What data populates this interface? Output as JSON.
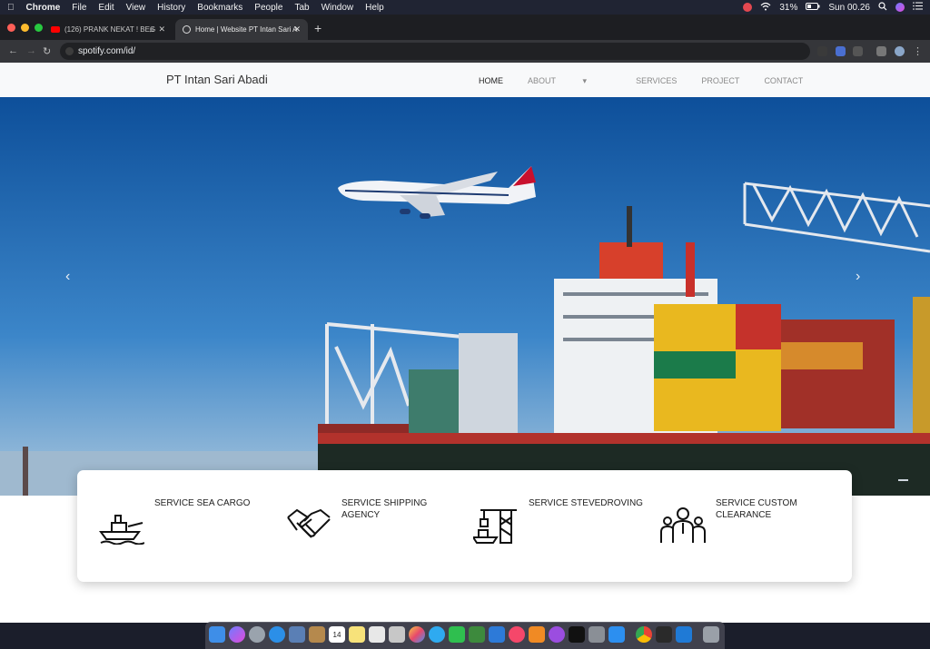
{
  "menubar": {
    "app": "Chrome",
    "items": [
      "File",
      "Edit",
      "View",
      "History",
      "Bookmarks",
      "People",
      "Tab",
      "Window",
      "Help"
    ],
    "battery": "31%",
    "clock": "Sun 00.26"
  },
  "tabs": [
    {
      "title": "(126) PRANK NEKAT ! BEG"
    },
    {
      "title": "Home | Website PT Intan Sari A"
    }
  ],
  "address": {
    "url": "spotify.com/id/"
  },
  "site": {
    "brand": "PT Intan Sari Abadi",
    "nav": [
      "HOME",
      "ABOUT",
      "SERVICES",
      "PROJECT",
      "CONTACT"
    ],
    "about_caret": "▾",
    "carousel": {
      "prev": "‹",
      "next": "›"
    },
    "services": [
      {
        "label": "SERVICE SEA CARGO",
        "icon": "ship-icon"
      },
      {
        "label": "SERVICE SHIPPING AGENCY",
        "icon": "handshake-icon"
      },
      {
        "label": "SERVICE STEVEDROVING",
        "icon": "crane-ship-icon"
      },
      {
        "label": "SERVICE CUSTOM CLEARANCE",
        "icon": "people-icon"
      }
    ]
  },
  "dock": {
    "calendar_day": "14"
  }
}
